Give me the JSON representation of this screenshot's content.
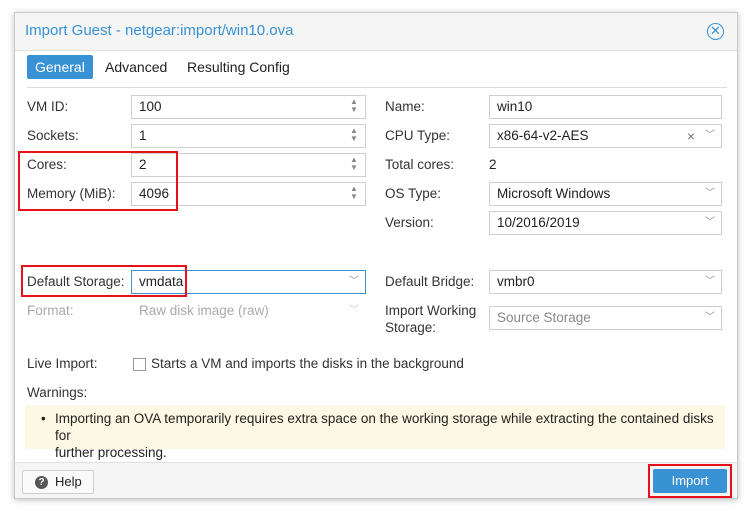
{
  "dialog": {
    "title": "Import Guest - netgear:import/win10.ova",
    "tabs": [
      "General",
      "Advanced",
      "Resulting Config"
    ],
    "active_tab": "General"
  },
  "left": {
    "vmid": {
      "label": "VM ID:",
      "value": "100"
    },
    "sockets": {
      "label": "Sockets:",
      "value": "1"
    },
    "cores": {
      "label": "Cores:",
      "value": "2"
    },
    "memory": {
      "label": "Memory (MiB):",
      "value": "4096"
    },
    "storage": {
      "label": "Default Storage:",
      "value": "vmdata"
    },
    "format": {
      "label": "Format:",
      "value": "Raw disk image (raw)"
    }
  },
  "right": {
    "name": {
      "label": "Name:",
      "value": "win10"
    },
    "cputype": {
      "label": "CPU Type:",
      "value": "x86-64-v2-AES"
    },
    "totalcores": {
      "label": "Total cores:",
      "value": "2"
    },
    "ostype": {
      "label": "OS Type:",
      "value": "Microsoft Windows"
    },
    "version": {
      "label": "Version:",
      "value": "10/2016/2019"
    },
    "bridge": {
      "label": "Default Bridge:",
      "value": "vmbr0"
    },
    "working_storage": {
      "label_line1": "Import Working",
      "label_line2": "Storage:",
      "placeholder": "Source Storage"
    }
  },
  "live_import": {
    "label": "Live Import:",
    "text": "Starts a VM and imports the disks in the background",
    "checked": false
  },
  "warnings": {
    "label": "Warnings:",
    "line1": "Importing an OVA temporarily requires extra space on the working storage while extracting the contained disks for",
    "line2": "further processing."
  },
  "footer": {
    "help_label": "Help",
    "import_label": "Import"
  },
  "colors": {
    "accent": "#3892d4",
    "highlight": "#e8101a",
    "warning_bg": "#fcf8e3"
  }
}
